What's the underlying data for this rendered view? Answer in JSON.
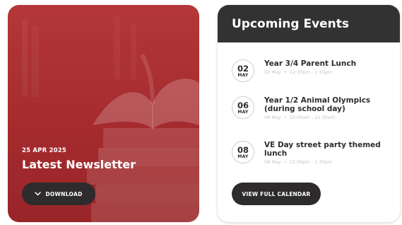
{
  "newsletter": {
    "date": "25 APR 2025",
    "title": "Latest Newsletter",
    "download_label": "DOWNLOAD",
    "download_icon": "chevron-down-icon",
    "card_color": "#b03335"
  },
  "events": {
    "heading": "Upcoming Events",
    "items": [
      {
        "day": "02",
        "month": "MAY",
        "title": "Year 3/4 Parent Lunch",
        "date": "02 May",
        "time": "12:30pm - 1:15pm"
      },
      {
        "day": "06",
        "month": "MAY",
        "title": "Year 1/2 Animal Olympics (during school day)",
        "date": "06 May",
        "time": "10:00am - 11:30am"
      },
      {
        "day": "08",
        "month": "MAY",
        "title": "VE Day street party themed lunch",
        "date": "08 May",
        "time": "12:00pm - 1:30pm"
      }
    ],
    "separator": "•",
    "calendar_button": "VIEW FULL CALENDAR"
  },
  "colors": {
    "dark": "#323232",
    "button": "#2e2b2c",
    "muted_text": "#c4c4c4"
  }
}
